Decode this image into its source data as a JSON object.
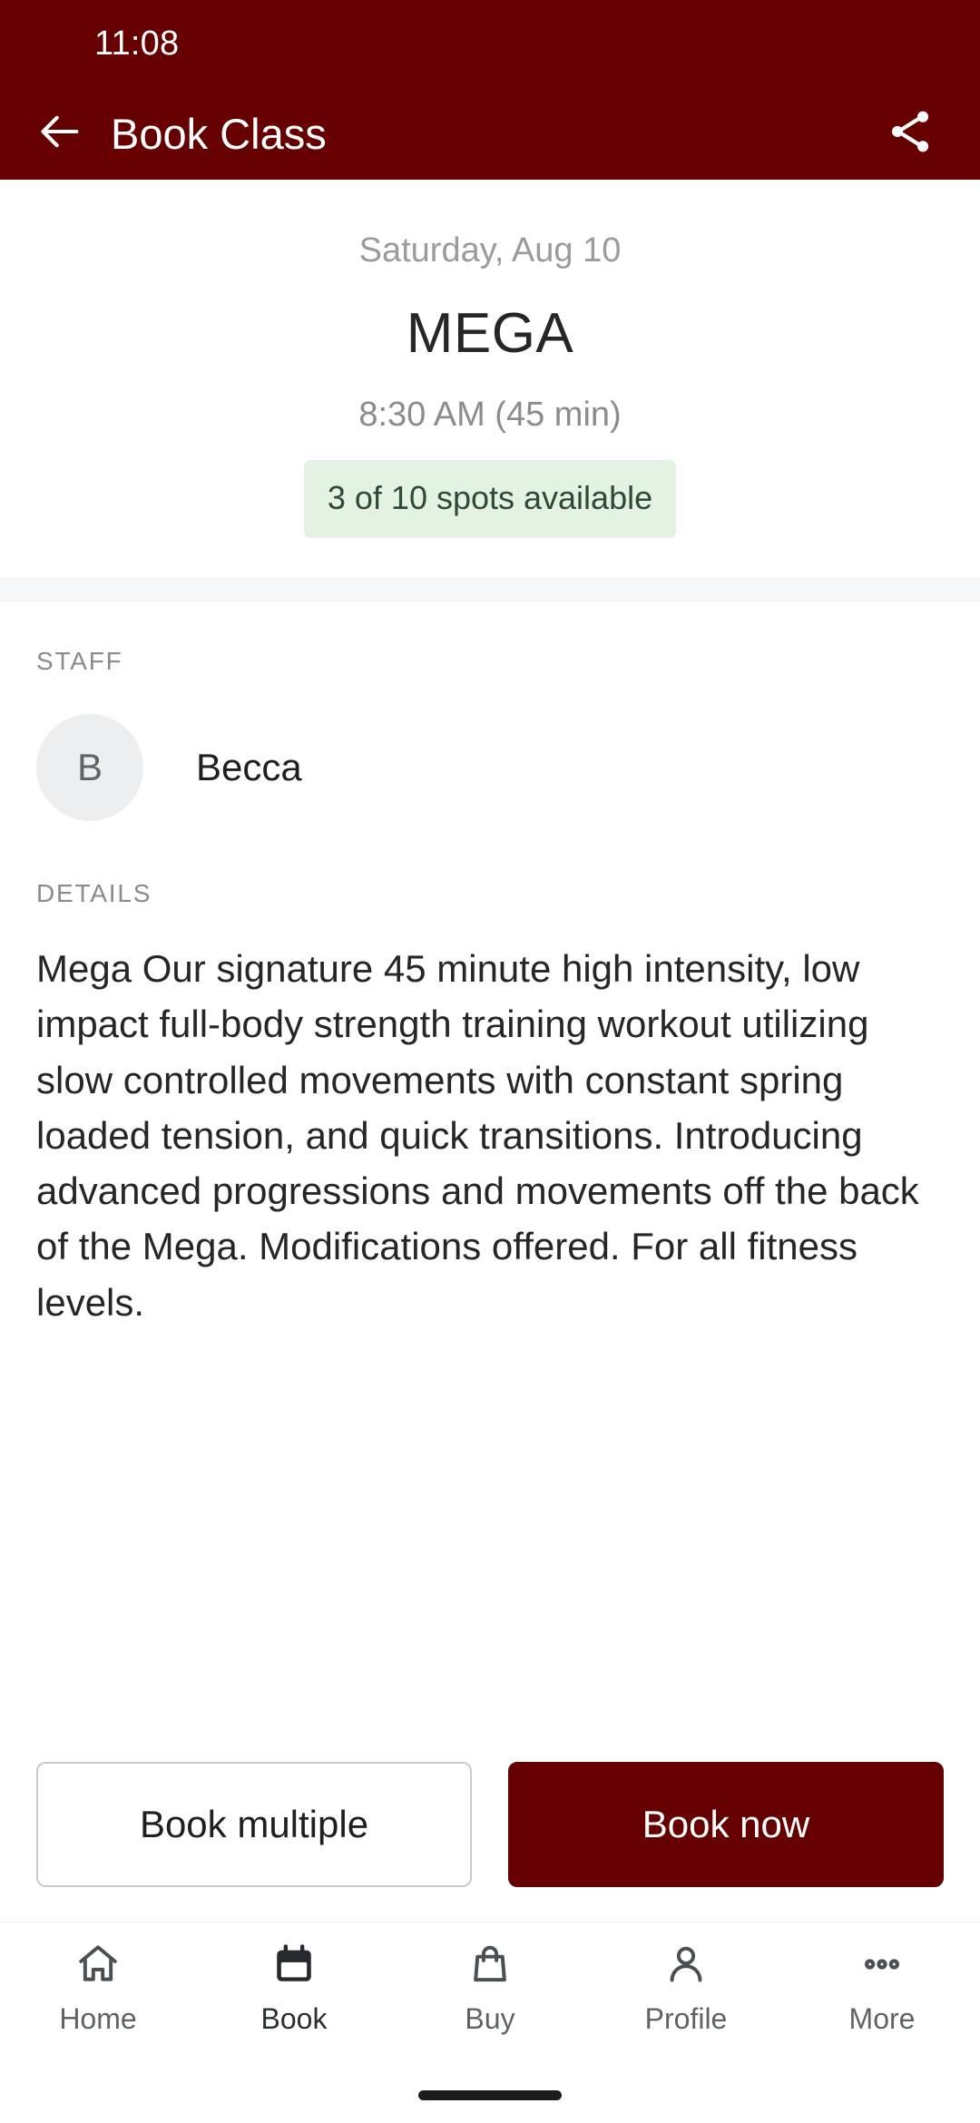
{
  "status_bar": {
    "clock": "11:08"
  },
  "app_bar": {
    "title": "Book Class",
    "back_icon": "arrow-left-icon",
    "share_icon": "share-icon"
  },
  "class_summary": {
    "date": "Saturday, Aug 10",
    "name": "MEGA",
    "time": "8:30 AM (45 min)",
    "spots": "3 of 10 spots available",
    "spots_available": 3,
    "spots_total": 10
  },
  "staff_section": {
    "label": "STAFF",
    "members": [
      {
        "initial": "B",
        "name": "Becca"
      }
    ]
  },
  "details_section": {
    "label": "DETAILS",
    "text": "Mega Our signature 45 minute high intensity, low impact full-body strength training workout utilizing slow controlled movements with constant spring loaded tension, and quick transitions. Introducing advanced progressions and movements off the back of the Mega. Modifications offered. For all fitness levels."
  },
  "actions": {
    "secondary_label": "Book multiple",
    "primary_label": "Book now"
  },
  "bottom_nav": {
    "items": [
      {
        "label": "Home",
        "icon": "home-icon",
        "active": false
      },
      {
        "label": "Book",
        "icon": "calendar-icon",
        "active": true
      },
      {
        "label": "Buy",
        "icon": "shopping-bag-icon",
        "active": false
      },
      {
        "label": "Profile",
        "icon": "person-icon",
        "active": false
      },
      {
        "label": "More",
        "icon": "ellipsis-icon",
        "active": false
      }
    ]
  },
  "colors": {
    "brand": "#660000",
    "badge_bg": "#e3f2e3",
    "badge_text": "#2f4a33",
    "muted_text": "#8c8c8c",
    "body_text": "#262626"
  }
}
